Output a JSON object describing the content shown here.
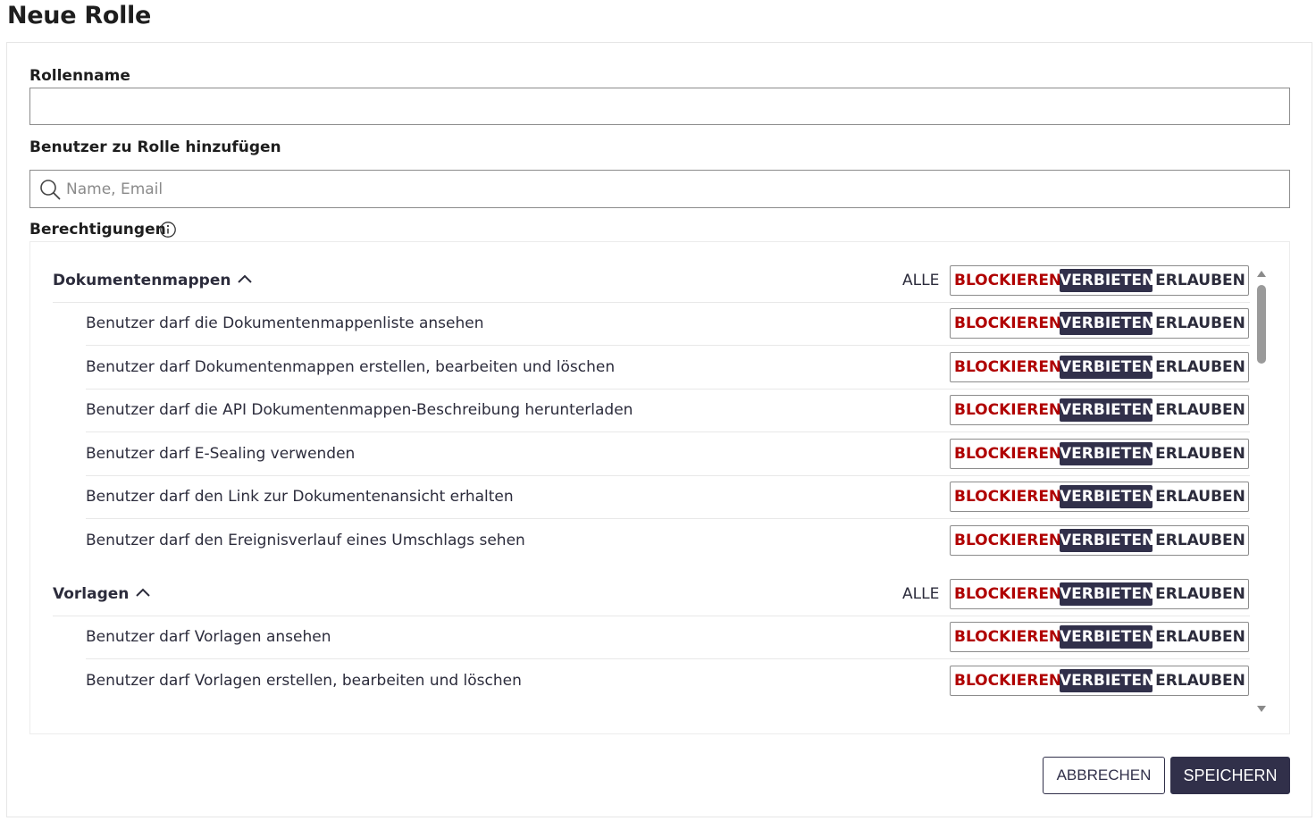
{
  "page": {
    "title": "Neue Rolle"
  },
  "form": {
    "role_name_label": "Rollenname",
    "role_name_value": "",
    "users_label": "Benutzer zu Rolle hinzufügen",
    "users_placeholder": "Name, Email",
    "permissions_label": "Berechtigungen"
  },
  "segment_labels": {
    "block": "BLOCKIEREN",
    "deny": "VERBIETEN",
    "allow": "ERLAUBEN",
    "all": "ALLE"
  },
  "permission_groups": [
    {
      "title": "Dokumentenmappen",
      "expanded": true,
      "selected": "VERBIETEN",
      "items": [
        {
          "text": "Benutzer darf die Dokumentenmappenliste ansehen",
          "selected": "VERBIETEN"
        },
        {
          "text": "Benutzer darf Dokumentenmappen erstellen, bearbeiten und löschen",
          "selected": "VERBIETEN"
        },
        {
          "text": "Benutzer darf die API Dokumentenmappen-Beschreibung herunterladen",
          "selected": "VERBIETEN"
        },
        {
          "text": "Benutzer darf E-Sealing verwenden",
          "selected": "VERBIETEN"
        },
        {
          "text": "Benutzer darf den Link zur Dokumentenansicht erhalten",
          "selected": "VERBIETEN"
        },
        {
          "text": "Benutzer darf den Ereignisverlauf eines Umschlags sehen",
          "selected": "VERBIETEN"
        }
      ]
    },
    {
      "title": "Vorlagen",
      "expanded": true,
      "selected": "VERBIETEN",
      "items": [
        {
          "text": "Benutzer darf Vorlagen ansehen",
          "selected": "VERBIETEN"
        },
        {
          "text": "Benutzer darf Vorlagen erstellen, bearbeiten und löschen",
          "selected": "VERBIETEN"
        }
      ]
    }
  ],
  "actions": {
    "cancel_label": "ABBRECHEN",
    "save_label": "SPEICHERN"
  },
  "colors": {
    "accent": "#31304a",
    "block_red": "#b00000",
    "border": "#8c8c8c"
  },
  "icons": {
    "search": "search-icon",
    "info": "info-icon",
    "chevron": "chevron-up-icon"
  }
}
